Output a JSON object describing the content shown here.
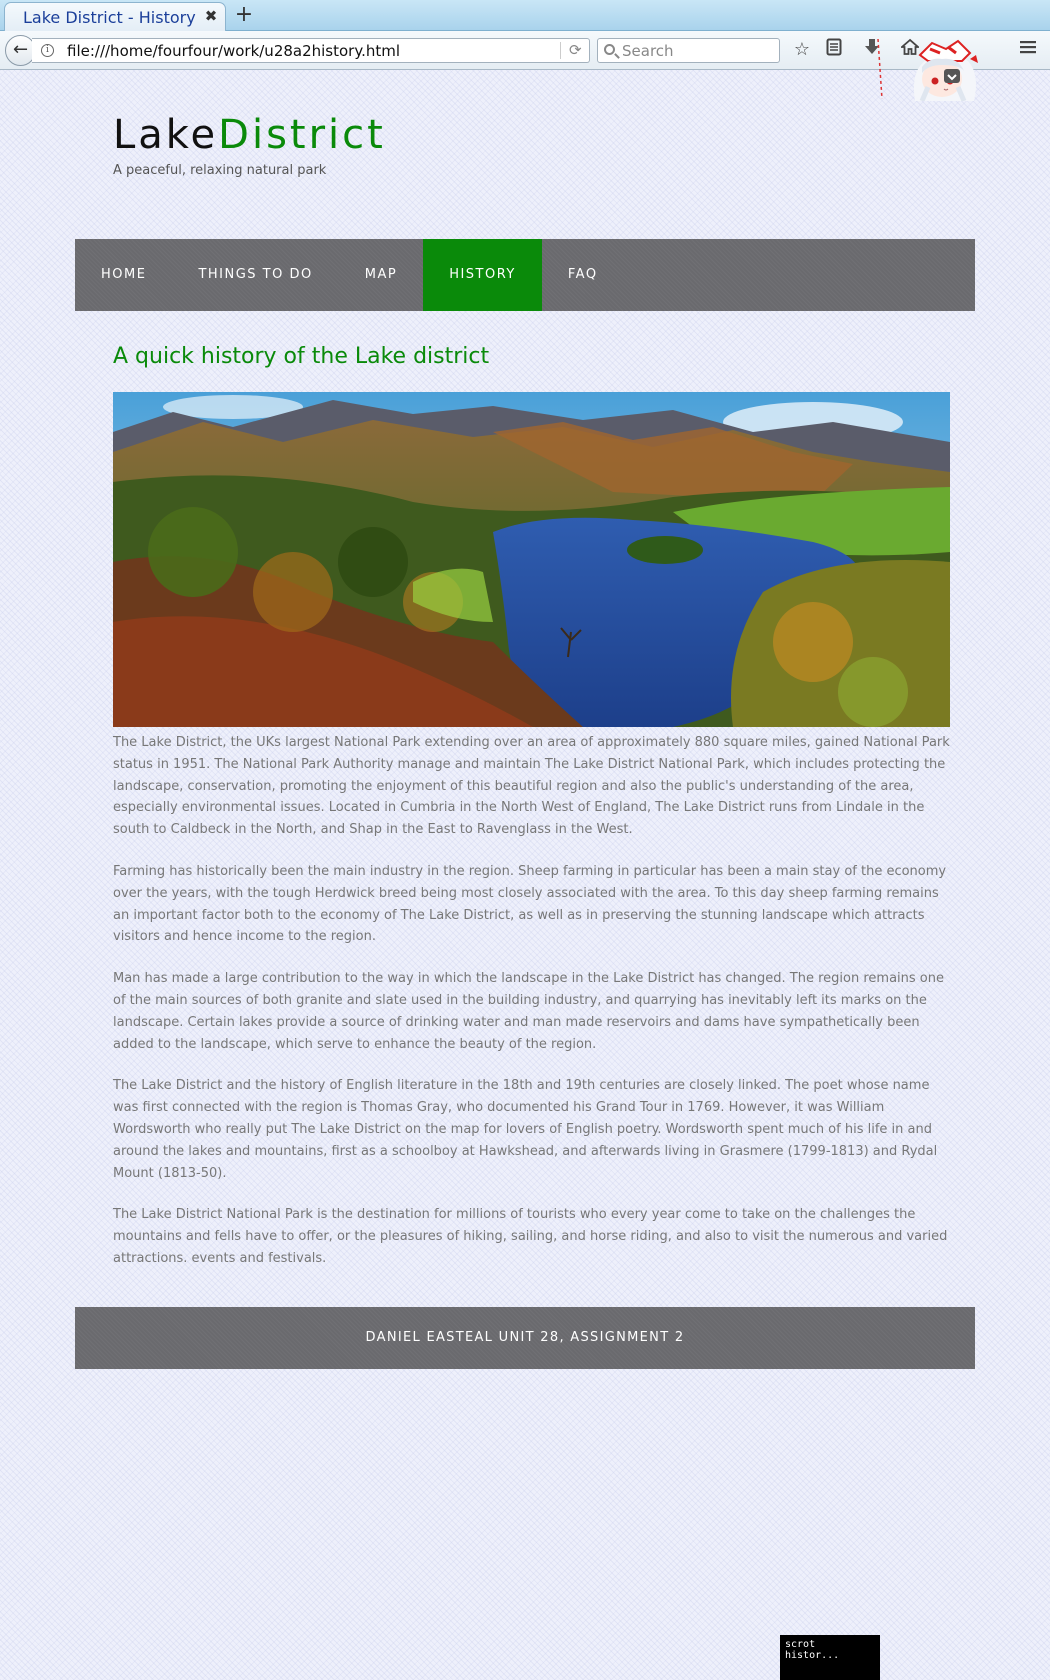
{
  "browser": {
    "tab_title": "Lake District - History",
    "tab_close": "✖",
    "new_tab": "+",
    "url": "file:///home/fourfour/work/u28a2history.html",
    "search_placeholder": "Search"
  },
  "site": {
    "title_part1": "Lake",
    "title_part2": "District",
    "tagline": "A peaceful, relaxing natural park",
    "accent_color": "#0a8a0a"
  },
  "nav": {
    "items": [
      {
        "label": "HOME",
        "active": false
      },
      {
        "label": "THINGS TO DO",
        "active": false
      },
      {
        "label": "MAP",
        "active": false
      },
      {
        "label": "HISTORY",
        "active": true
      },
      {
        "label": "FAQ",
        "active": false
      }
    ]
  },
  "main": {
    "heading": "A quick history of the Lake district",
    "paragraphs": [
      "The Lake District, the UKs largest National Park extending over an area of approximately 880 square miles, gained National Park status in 1951. The National Park Authority manage and maintain The Lake District National Park, which includes protecting the landscape, conservation, promoting the enjoyment of this beautiful region and also the public's understanding of the area, especially environmental issues. Located in Cumbria in the North West of England, The Lake District runs from Lindale in the south to Caldbeck in the North, and Shap in the East to Ravenglass in the West.",
      "Farming has historically been the main industry in the region. Sheep farming in particular has been a main stay of the economy over the years, with the tough Herdwick breed being most closely associated with the area. To this day sheep farming remains an important factor both to the economy of The Lake District, as well as in preserving the stunning landscape which attracts visitors and hence income to the region.",
      "Man has made a large contribution to the way in which the landscape in the Lake District has changed. The region remains one of the main sources of both granite and slate used in the building industry, and quarrying has inevitably left its marks on the landscape. Certain lakes provide a source of drinking water and man made reservoirs and dams have sympathetically been added to the landscape, which serve to enhance the beauty of the region.",
      "The Lake District and the history of English literature in the 18th and 19th centuries are closely linked. The poet whose name was first connected with the region is Thomas Gray, who documented his Grand Tour in 1769. However, it was William Wordsworth who really put The Lake District on the map for lovers of English poetry. Wordsworth spent much of his life in and around the lakes and mountains, first as a schoolboy at Hawkshead, and afterwards living in Grasmere (1799-1813) and Rydal Mount (1813-50).",
      "The Lake District National Park is the destination for millions of tourists who every year come to take on the challenges the mountains and fells have to offer, or the pleasures of hiking, sailing, and horse riding, and also to visit the numerous and varied attractions. events and festivals."
    ]
  },
  "footer": {
    "text": "DANIEL EASTEAL UNIT 28, ASSIGNMENT 2"
  },
  "taskbar": {
    "label": "scrot histor..."
  }
}
